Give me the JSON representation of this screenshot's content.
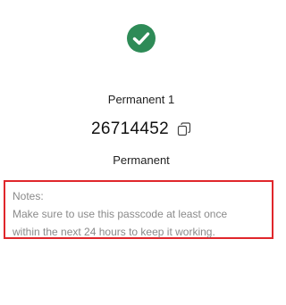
{
  "header": {
    "status_icon": "check-circle-icon",
    "status_color": "#2e8b57"
  },
  "passcode": {
    "name": "Permanent 1",
    "code": "26714452",
    "copy_icon": "copy-icon",
    "type": "Permanent"
  },
  "notes": {
    "label": "Notes:",
    "line1": "Make sure to use this passcode at least once",
    "line2": "within the next 24 hours to keep it working.",
    "border_color": "#e0262b"
  }
}
